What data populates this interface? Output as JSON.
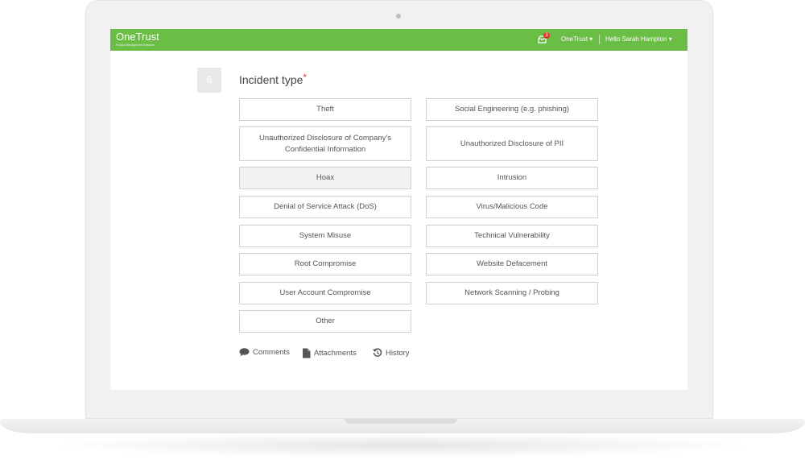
{
  "app": {
    "brand": "OneTrust",
    "brand_tagline": "Privacy Management Software",
    "accent_color": "#6abd45"
  },
  "header": {
    "notification_count": "3",
    "org_menu": "OneTrust ▾",
    "user_menu": "Hello Sarah Hampton ▾"
  },
  "question": {
    "number": "6",
    "title": "Incident type",
    "required_marker": "*",
    "selected": "Hoax",
    "options_left": [
      "Theft",
      "Unauthorized Disclosure of Company's Confidential Information",
      "Hoax",
      "Denial of Service Attack (DoS)",
      "System Misuse",
      "Root Compromise",
      "User Account Compromise",
      "Other"
    ],
    "options_right": [
      "Social Engineering (e.g. phishing)",
      "Unauthorized Disclosure of PII",
      "Intrusion",
      "Virus/Malicious Code",
      "Technical Vulnerability",
      "Website Defacement",
      "Network Scanning / Probing"
    ]
  },
  "footer": {
    "comments": "Comments",
    "attachments": "Attachments",
    "history": "History"
  },
  "icons": [
    "notification-icon",
    "comment-icon",
    "attachment-icon",
    "history-icon"
  ]
}
